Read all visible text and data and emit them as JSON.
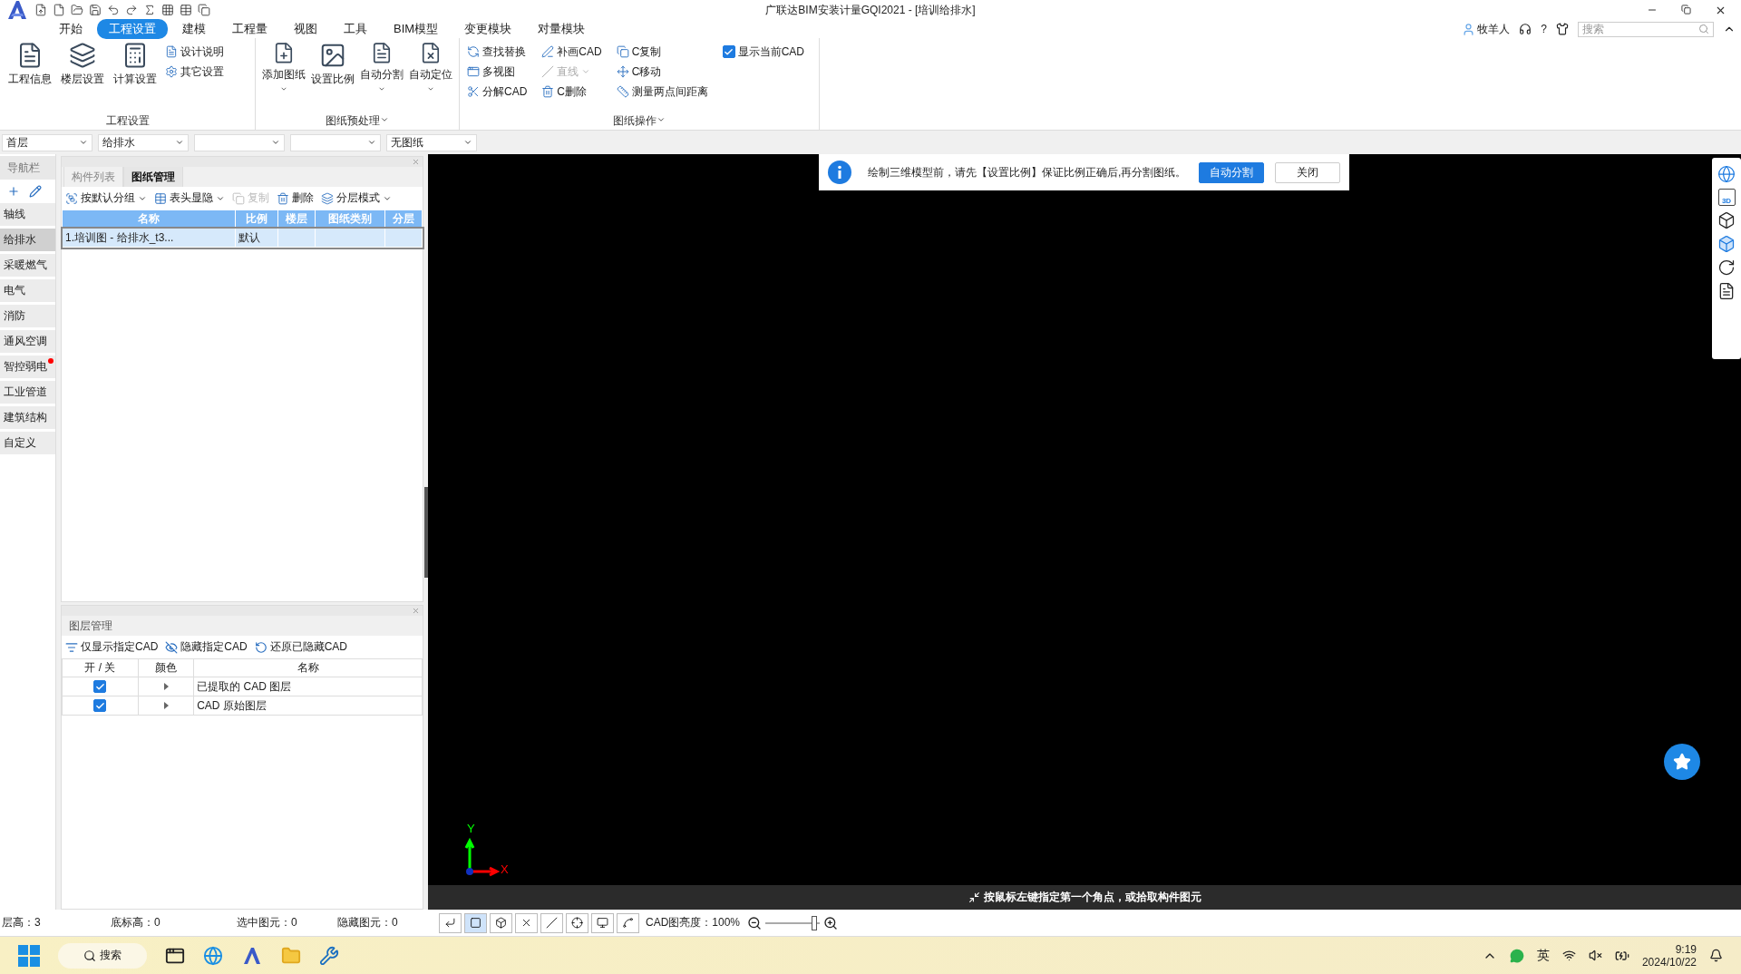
{
  "window": {
    "title": "广联达BIM安装计量GQI2021 - [培训给排水]"
  },
  "menu_tabs": [
    {
      "label": "开始",
      "selected": false
    },
    {
      "label": "工程设置",
      "selected": true
    },
    {
      "label": "建模",
      "selected": false
    },
    {
      "label": "工程量",
      "selected": false
    },
    {
      "label": "视图",
      "selected": false
    },
    {
      "label": "工具",
      "selected": false
    },
    {
      "label": "BIM模型",
      "selected": false
    },
    {
      "label": "变更模块",
      "selected": false
    },
    {
      "label": "对量模块",
      "selected": false
    }
  ],
  "account": {
    "user": "牧羊人",
    "help": "?",
    "search_placeholder": "搜索"
  },
  "ribbon": [
    {
      "title": "工程设置",
      "items": [
        {
          "kind": "large",
          "label": "工程信息"
        },
        {
          "kind": "large",
          "label": "楼层设置"
        },
        {
          "kind": "large",
          "label": "计算设置"
        },
        {
          "kind": "small",
          "label": "设计说明"
        },
        {
          "kind": "small",
          "label": "其它设置"
        }
      ]
    },
    {
      "title": "图纸预处理",
      "dropdown": true,
      "items": [
        {
          "kind": "large",
          "label": "添加图纸",
          "dropdown": true
        },
        {
          "kind": "large",
          "label": "设置比例",
          "dropdown": false
        },
        {
          "kind": "large",
          "label": "自动分割",
          "dropdown": true
        },
        {
          "kind": "large",
          "label": "自动定位",
          "dropdown": true
        }
      ]
    },
    {
      "title": "图纸操作",
      "dropdown": true,
      "items": [
        {
          "kind": "small",
          "label": "查找替换"
        },
        {
          "kind": "small",
          "label": "多视图"
        },
        {
          "kind": "small",
          "label": "分解CAD"
        },
        {
          "kind": "small",
          "label": "补画CAD"
        },
        {
          "kind": "small",
          "label": "直线",
          "disabled": true,
          "dropdown": true
        },
        {
          "kind": "small",
          "label": "C删除"
        },
        {
          "kind": "small",
          "label": "C复制"
        },
        {
          "kind": "small",
          "label": "C移动"
        },
        {
          "kind": "small",
          "label": "测量两点间距离"
        },
        {
          "kind": "check",
          "label": "显示当前CAD",
          "checked": true
        }
      ]
    }
  ],
  "selectors": {
    "floor": "首层",
    "specialty": "给排水",
    "drawing": "无图纸"
  },
  "nav": {
    "title": "导航栏",
    "items": [
      {
        "label": "轴线",
        "selected": false
      },
      {
        "label": "给排水",
        "selected": true
      },
      {
        "label": "采暖燃气",
        "selected": false
      },
      {
        "label": "电气",
        "selected": false
      },
      {
        "label": "消防",
        "selected": false
      },
      {
        "label": "通风空调",
        "selected": false
      },
      {
        "label": "智控弱电",
        "selected": false,
        "notification": true
      },
      {
        "label": "工业管道",
        "selected": false
      },
      {
        "label": "建筑结构",
        "selected": false
      },
      {
        "label": "自定义",
        "selected": false
      }
    ]
  },
  "drawing_panel": {
    "tabs": [
      {
        "label": "构件列表",
        "selected": false
      },
      {
        "label": "图纸管理",
        "selected": true
      }
    ],
    "toolbar": [
      {
        "label": "按默认分组",
        "dropdown": true
      },
      {
        "label": "表头显隐",
        "dropdown": true
      },
      {
        "label": "复制",
        "disabled": true
      },
      {
        "label": "删除",
        "disabled": false
      },
      {
        "label": "分层模式",
        "dropdown": true
      }
    ],
    "columns": [
      "名称",
      "比例",
      "楼层",
      "图纸类别",
      "分层"
    ],
    "rows": [
      {
        "selected": true,
        "cells": [
          "1.培训图 - 给排水_t3...",
          "默认"
        ]
      }
    ]
  },
  "layer_panel": {
    "title": "图层管理",
    "toolbar": [
      "仅显示指定CAD",
      "隐藏指定CAD",
      "还原已隐藏CAD"
    ],
    "columns": [
      "开 / 关",
      "颜色",
      "名称"
    ],
    "rows": [
      {
        "checked": true,
        "name": "已提取的 CAD 图层"
      },
      {
        "checked": true,
        "name": "CAD 原始图层"
      }
    ]
  },
  "notice": {
    "message": "绘制三维模型前，请先【设置比例】保证比例正确后,再分割图纸。",
    "buttons": [
      {
        "label": "自动分割",
        "primary": true
      },
      {
        "label": "关闭",
        "primary": false
      }
    ]
  },
  "canvas": {
    "axis_x": "X",
    "axis_y": "Y",
    "prompt": "按鼠标左键指定第一个角点，或拾取构件图元",
    "view_badge": "3D"
  },
  "status_bar": {
    "fields": [
      "层高：3",
      "底标高：0",
      "选中图元：0",
      "隐藏图元：0"
    ],
    "brightness_label": "CAD图亮度：100%",
    "brightness": {
      "level": 0.9
    }
  },
  "taskbar": {
    "search": "搜索",
    "ime": "英",
    "time": "9:19",
    "date": "2024/10/22"
  }
}
